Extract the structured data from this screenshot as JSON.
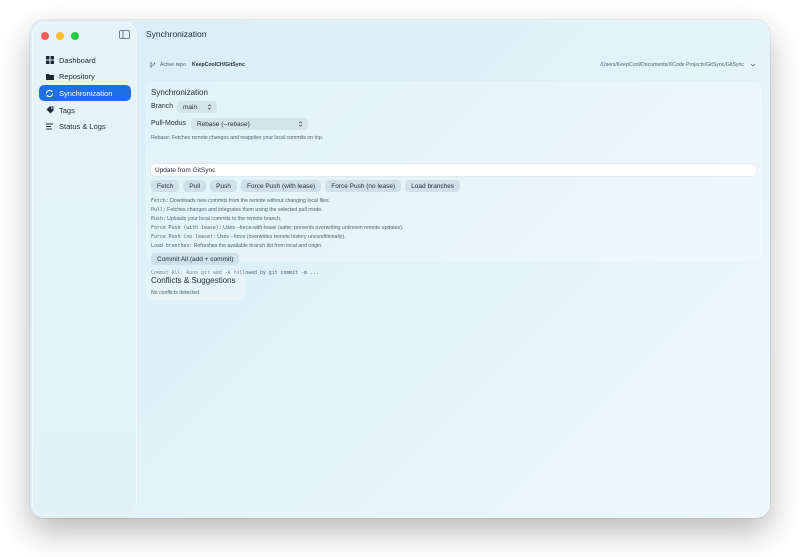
{
  "window": {
    "title": "Synchronization"
  },
  "sidebar": {
    "items": [
      {
        "label": "Dashboard",
        "icon": "grid-icon"
      },
      {
        "label": "Repository",
        "icon": "folder-icon"
      },
      {
        "label": "Synchronization",
        "icon": "sync-icon",
        "active": true
      },
      {
        "label": "Tags",
        "icon": "tag-icon"
      },
      {
        "label": "Status & Logs",
        "icon": "list-icon"
      }
    ]
  },
  "repo_bar": {
    "label": "Active repo",
    "name": "KeepCoolCH/GitSync",
    "path": "/Users/KeepCool/Documents/XCode Projects/GitSync/GitSync"
  },
  "sync": {
    "title": "Synchronization",
    "branch_label": "Branch",
    "branch_value": "main",
    "pull_label": "Pull-Modus",
    "pull_value": "Rebase (--rebase)",
    "rebase_hint": "Rebase: Fetches remote changes and reapplies your local commits on top.",
    "commit_message": "Update from GitSync",
    "buttons": {
      "fetch": "Fetch",
      "pull": "Pull",
      "push": "Push",
      "force_lease": "Force Push (with lease)",
      "force_no_lease": "Force Push (no lease)",
      "load_branches": "Load branches"
    },
    "descriptions": [
      {
        "key": "Fetch:",
        "text": " Downloads new commits from the remote without changing local files."
      },
      {
        "key": "Pull:",
        "text": " Fetches changes and integrates them using the selected pull mode."
      },
      {
        "key": "Push:",
        "text": " Uploads your local commits to the remote branch."
      },
      {
        "key": "Force Push (with lease):",
        "text": " Uses --force-with-lease (safer; prevents overwriting unknown remote updates)."
      },
      {
        "key": "Force Push (no lease):",
        "text": " Uses --force (overwrites remote history unconditionally)."
      },
      {
        "key": "Load branches:",
        "text": " Refreshes the available branch list from local and origin."
      }
    ],
    "commit_all_label": "Commit All (add + commit)",
    "commit_all_hint": "Commit All: Runs git add -A followed by git commit -m ..."
  },
  "conflicts": {
    "title": "Conflicts & Suggestions",
    "status": "No conflicts detected."
  },
  "colors": {
    "accent": "#1f6fe5",
    "traffic_red": "#ff5f57",
    "traffic_yellow": "#febc2e",
    "traffic_green": "#28c840"
  }
}
